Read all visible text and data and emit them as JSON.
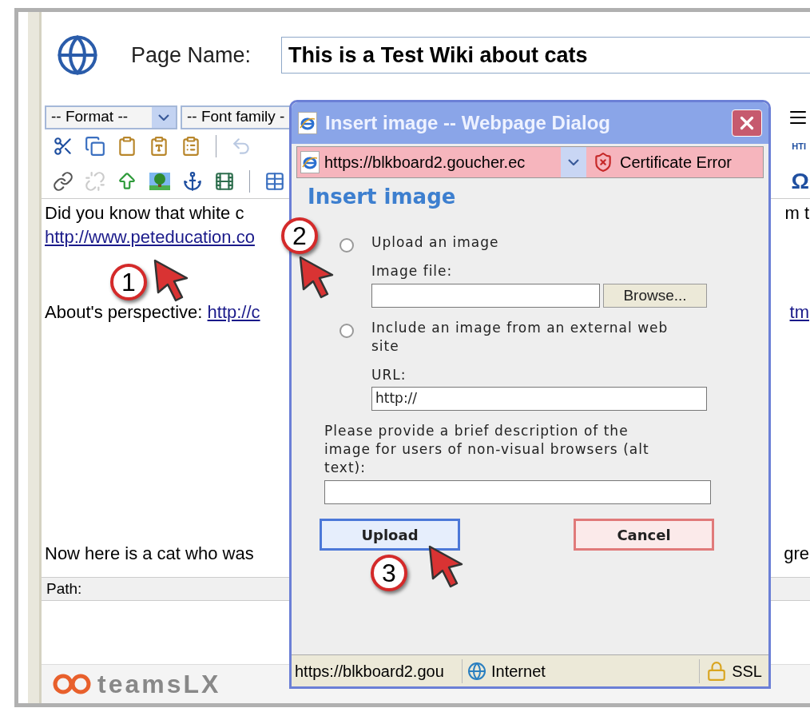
{
  "page_name": {
    "label": "Page Name:",
    "value": "This is a Test Wiki about cats"
  },
  "toolbar": {
    "selects": [
      "-- Format --",
      "-- Font family -"
    ],
    "rows": [
      [
        {
          "kind": "cut",
          "disabled": false
        },
        {
          "kind": "copy",
          "disabled": false
        },
        {
          "kind": "paste",
          "disabled": false
        },
        {
          "kind": "paste-text",
          "disabled": false
        },
        {
          "kind": "paste-word",
          "disabled": false
        },
        {
          "kind": "separator",
          "disabled": false
        },
        {
          "kind": "undo",
          "disabled": true
        }
      ],
      [
        {
          "kind": "link",
          "disabled": false
        },
        {
          "kind": "unlink",
          "disabled": true
        },
        {
          "kind": "upload",
          "disabled": false
        },
        {
          "kind": "image",
          "disabled": false
        },
        {
          "kind": "anchor",
          "disabled": false
        },
        {
          "kind": "media",
          "disabled": false
        },
        {
          "kind": "separator",
          "disabled": false
        },
        {
          "kind": "table",
          "disabled": false
        }
      ]
    ],
    "right_labels": [
      "HTI",
      "Ω"
    ]
  },
  "content": [
    {
      "left": [
        {
          "text": "Did you know that white c",
          "link": false
        }
      ],
      "right": [
        {
          "text": "m t",
          "link": false
        }
      ]
    },
    {
      "left": [
        {
          "text": "http://www.peteducation.co",
          "link": true
        }
      ]
    },
    {
      "left": [
        {
          "text": "About's perspective: ",
          "link": false
        },
        {
          "text": "http://c",
          "link": true
        }
      ],
      "right": [
        {
          "text": "tm",
          "link": true
        }
      ]
    },
    {
      "left": [
        {
          "text": "Now here is a cat who was",
          "link": false
        }
      ],
      "right": [
        {
          "text": "gre",
          "link": false
        }
      ]
    }
  ],
  "path_label": "Path:",
  "logo": "teamsLX",
  "dialog": {
    "title": "Insert image -- Webpage Dialog",
    "address": {
      "url": "https://blkboard2.goucher.ec",
      "error": "Certificate Error"
    },
    "heading": "Insert image",
    "options": [
      {
        "label": "Upload an image",
        "selected": false,
        "field_label": "Image file:",
        "button": "Browse..."
      },
      {
        "label": "Include an image from an external web site",
        "selected": false,
        "field_label": "URL:",
        "value": "http://"
      }
    ],
    "alt": {
      "label": "Please provide a brief description of the image for users of non-visual browsers (alt text):"
    },
    "buttons": [
      {
        "label": "Upload",
        "kind": "primary"
      },
      {
        "label": "Cancel",
        "kind": "cancel"
      }
    ],
    "status": {
      "url": "https://blkboard2.gou",
      "zone": "Internet",
      "security": "SSL"
    }
  },
  "callouts": [
    {
      "number": "1"
    },
    {
      "number": "2"
    },
    {
      "number": "3"
    }
  ]
}
